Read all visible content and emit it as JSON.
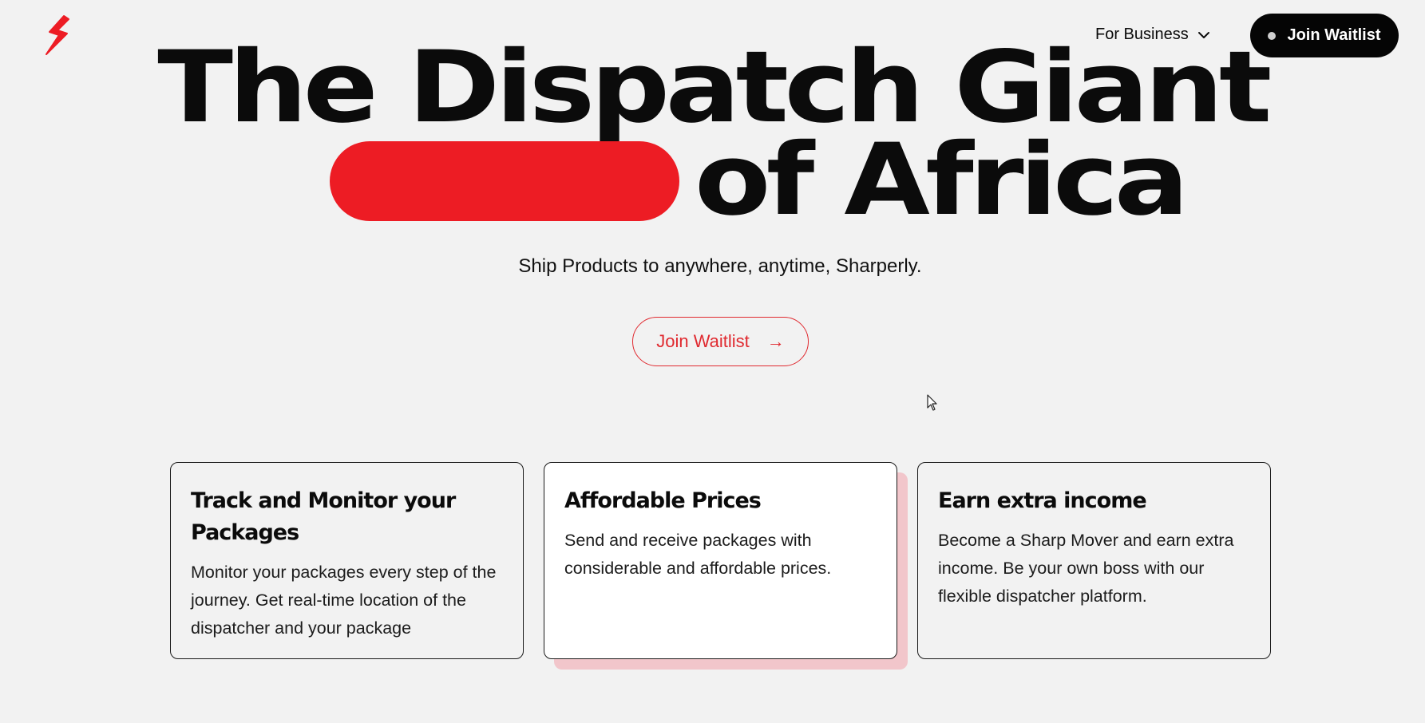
{
  "header": {
    "logo_icon": "lightning-bolt-icon",
    "nav_business_label": "For Business",
    "join_waitlist_label": "Join Waitlist"
  },
  "hero": {
    "title_line1": "The Dispatch Giant",
    "title_line2": "of Africa",
    "subtitle": "Ship Products to anywhere, anytime, Sharperly.",
    "cta_label": "Join Waitlist",
    "cta_arrow": "→"
  },
  "features": [
    {
      "title": "Track and Monitor your Packages",
      "description": "Monitor your packages every step of the journey. Get real-time location of the dispatcher and your package"
    },
    {
      "title": "Affordable Prices",
      "description": "Send and receive packages with considerable and affordable prices."
    },
    {
      "title": "Earn extra income",
      "description": "Become a Sharp Mover and earn extra income. Be your own boss with our flexible dispatcher platform."
    }
  ],
  "colors": {
    "brand_red": "#ed1c24",
    "background": "#f2f2f2",
    "dark": "#050505",
    "card_shadow": "#f2c6cb"
  }
}
